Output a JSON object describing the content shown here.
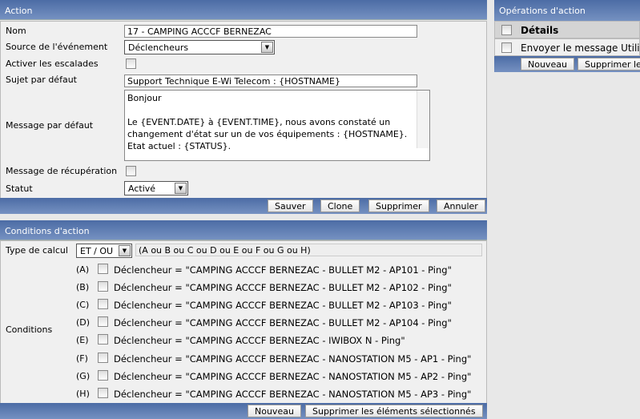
{
  "action": {
    "title": "Action",
    "fields": {
      "name_label": "Nom",
      "name_value": "17 - CAMPING ACCCF BERNEZAC",
      "source_label": "Source de l'événement",
      "source_value": "Déclencheurs",
      "escalation_label": "Activer les escalades",
      "subject_label": "Sujet par défaut",
      "subject_value": "Support Technique E-Wi Telecom : {HOSTNAME}",
      "message_label": "Message par défaut",
      "message_lines": [
        "Bonjour",
        "",
        "Le {EVENT.DATE} à {EVENT.TIME}, nous avons constaté un",
        "changement d'état sur un de vos équipements : {HOSTNAME}.",
        "Etat actuel : {STATUS}."
      ],
      "recovery_label": "Message de récupération",
      "status_label": "Statut",
      "status_value": "Activé"
    },
    "buttons": {
      "save": "Sauver",
      "clone": "Clone",
      "delete": "Supprimer",
      "cancel": "Annuler"
    }
  },
  "conditions": {
    "title": "Conditions d'action",
    "calc_label": "Type de calcul",
    "calc_value": "ET / OU",
    "formula": "(A ou B ou C ou D ou E ou F ou G ou H)",
    "conditions_label": "Conditions",
    "items": [
      {
        "id": "(A)",
        "text": "Déclencheur = \"CAMPING ACCCF BERNEZAC - BULLET M2 - AP101 - Ping\""
      },
      {
        "id": "(B)",
        "text": "Déclencheur = \"CAMPING ACCCF BERNEZAC - BULLET M2 - AP102 - Ping\""
      },
      {
        "id": "(C)",
        "text": "Déclencheur = \"CAMPING ACCCF BERNEZAC - BULLET M2 - AP103 - Ping\""
      },
      {
        "id": "(D)",
        "text": "Déclencheur = \"CAMPING ACCCF BERNEZAC - BULLET M2 - AP104 - Ping\""
      },
      {
        "id": "(E)",
        "text": "Déclencheur = \"CAMPING ACCCF BERNEZAC - IWIBOX N - Ping\""
      },
      {
        "id": "(F)",
        "text": "Déclencheur = \"CAMPING ACCCF BERNEZAC - NANOSTATION M5 - AP1 - Ping\""
      },
      {
        "id": "(G)",
        "text": "Déclencheur = \"CAMPING ACCCF BERNEZAC - NANOSTATION M5 - AP2 - Ping\""
      },
      {
        "id": "(H)",
        "text": "Déclencheur = \"CAMPING ACCCF BERNEZAC - NANOSTATION M5 - AP3 - Ping\""
      }
    ],
    "buttons": {
      "new": "Nouveau",
      "delete_selected": "Supprimer les éléments sélectionnés"
    }
  },
  "operations": {
    "title": "Opérations d'action",
    "col_details": "Détails",
    "rows": [
      "Envoyer le message Utilisateurs"
    ],
    "buttons": {
      "new": "Nouveau",
      "delete_selected": "Supprimer les éléments sélectionnés"
    }
  }
}
